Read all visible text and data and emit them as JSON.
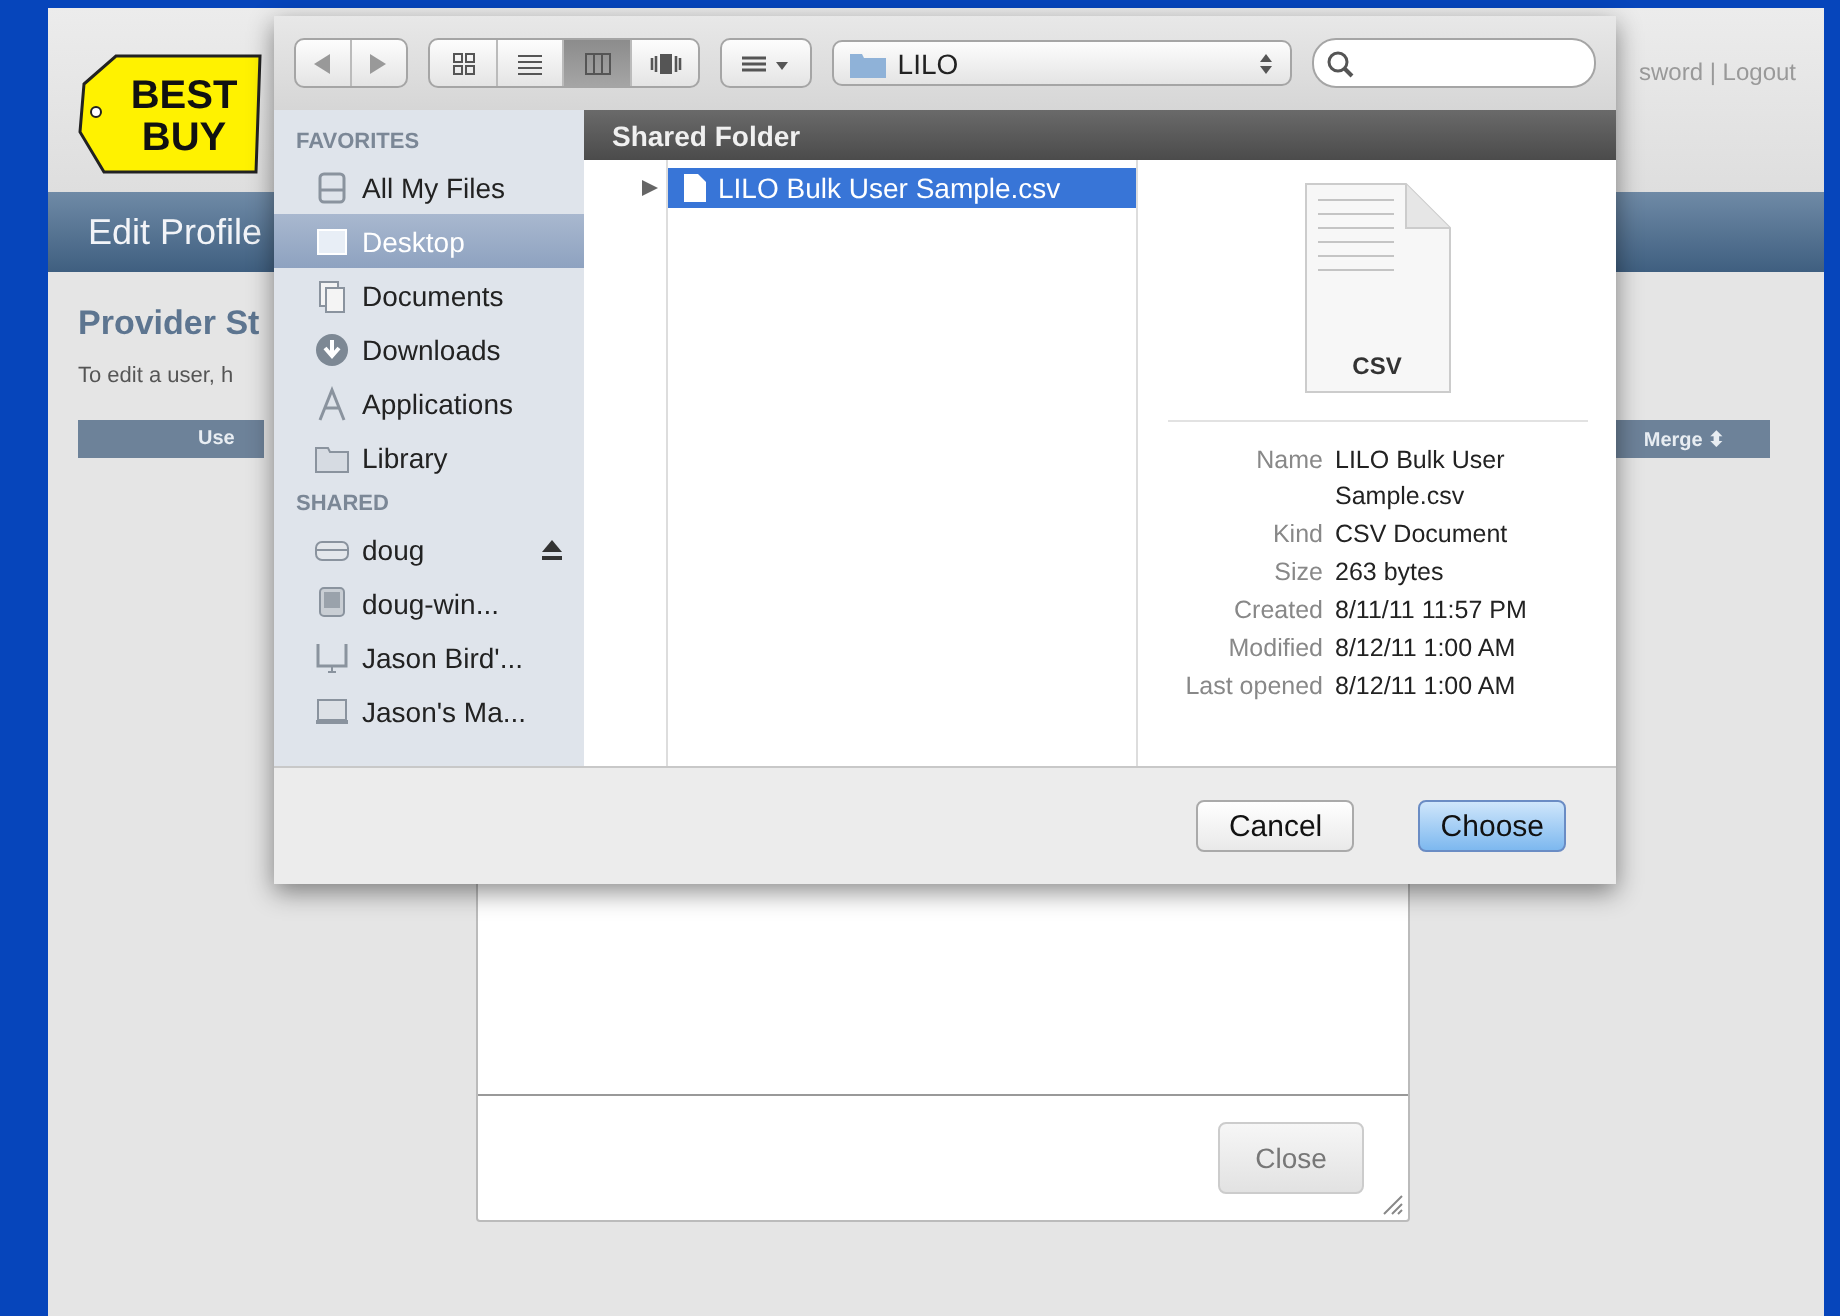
{
  "page": {
    "logo": [
      "BEST",
      "BUY"
    ],
    "account_links": "sword | Logout",
    "nav_title": "Edit Profile",
    "heading": "Provider St",
    "intro": "To edit a user, h",
    "buttons": [
      {
        "label": "Use"
      },
      {
        "label": "Merge ⬍"
      }
    ]
  },
  "modal": {
    "close_button": "Close"
  },
  "dialog": {
    "toolbar": {
      "views": [
        {
          "selected": false
        },
        {
          "selected": false
        },
        {
          "selected": true
        },
        {
          "selected": false
        }
      ],
      "path": "LILO"
    },
    "sidebar": [
      {
        "title": "FAVORITES",
        "items": [
          {
            "label": "All My Files",
            "selected": false,
            "ejectable": false
          },
          {
            "label": "Desktop",
            "selected": true,
            "ejectable": false
          },
          {
            "label": "Documents",
            "selected": false,
            "ejectable": false
          },
          {
            "label": "Downloads",
            "selected": false,
            "ejectable": false
          },
          {
            "label": "Applications",
            "selected": false,
            "ejectable": false
          },
          {
            "label": "Library",
            "selected": false,
            "ejectable": false
          }
        ]
      },
      {
        "title": "SHARED",
        "items": [
          {
            "label": "doug",
            "selected": false,
            "ejectable": true
          },
          {
            "label": "doug-win...",
            "selected": false,
            "ejectable": false
          },
          {
            "label": "Jason Bird'...",
            "selected": false,
            "ejectable": false
          },
          {
            "label": "Jason's Ma...",
            "selected": false,
            "ejectable": false
          }
        ]
      }
    ],
    "header": "Shared Folder",
    "files": [
      {
        "name": "LILO Bulk User Sample.csv",
        "selected": true
      }
    ],
    "preview": {
      "icon_label": "CSV",
      "info": [
        {
          "label": "Name",
          "value": "LILO Bulk User Sample.csv"
        },
        {
          "label": "Kind",
          "value": "CSV Document"
        },
        {
          "label": "Size",
          "value": "263 bytes"
        },
        {
          "label": "Created",
          "value": "8/11/11 11:57 PM"
        },
        {
          "label": "Modified",
          "value": "8/12/11 1:00 AM"
        },
        {
          "label": "Last opened",
          "value": "8/12/11 1:00 AM"
        }
      ]
    },
    "buttons": [
      {
        "label": "Cancel",
        "default": false
      },
      {
        "label": "Choose",
        "default": true
      }
    ]
  }
}
